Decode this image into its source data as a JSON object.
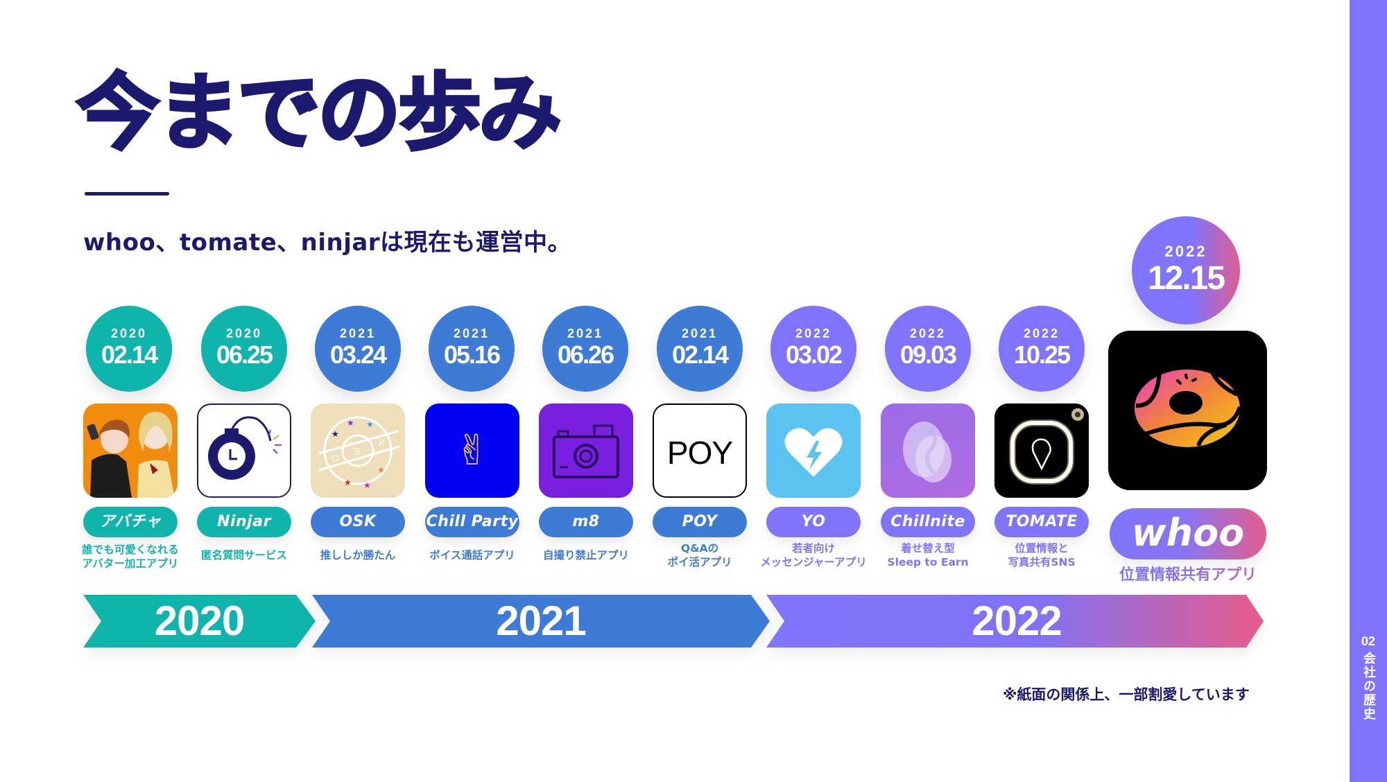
{
  "header": {
    "title": "今までの歩み",
    "subtitle": "whoo、tomate、ninjarは現在も運営中。"
  },
  "sidebar": {
    "section_number": "02",
    "section_label": "会社の歴史"
  },
  "colors": {
    "navy": "#1c1a6e",
    "teal_2020": "#0fb5ad",
    "blue_2021": "#3e7bd6",
    "purple_2022": "#7f74fb",
    "pink_accent": "#e45d8c"
  },
  "apps": [
    {
      "year": "2020",
      "date": "02.14",
      "name": "アバチャ",
      "desc": "誰でも可愛くなれる\nアバター加工アプリ",
      "icon": "avatar-photo-icon",
      "theme": "teal"
    },
    {
      "year": "2020",
      "date": "06.25",
      "name": "Ninjar",
      "desc": "匿名質問サービス",
      "icon": "bomb-clock-icon",
      "theme": "teal"
    },
    {
      "year": "2021",
      "date": "03.24",
      "name": "OSK",
      "desc": "推ししか勝たん",
      "icon": "osk-stars-logo-icon",
      "theme": "blue"
    },
    {
      "year": "2021",
      "date": "05.16",
      "name": "Chill Party",
      "desc": "ボイス通話アプリ",
      "icon": "peace-hand-icon",
      "theme": "blue"
    },
    {
      "year": "2021",
      "date": "06.26",
      "name": "m8",
      "desc": "自撮り禁止アプリ",
      "icon": "camera-icon",
      "theme": "blue"
    },
    {
      "year": "2021",
      "date": "02.14",
      "name": "POY",
      "desc": "Q&Aの\nポイ活アプリ",
      "icon": "poy-wordmark-icon",
      "icon_text": "POY",
      "theme": "blue"
    },
    {
      "year": "2022",
      "date": "03.02",
      "name": "YO",
      "desc": "若者向け\nメッセンジャーアプリ",
      "icon": "heart-bolt-icon",
      "theme": "purple"
    },
    {
      "year": "2022",
      "date": "09.03",
      "name": "Chillnite",
      "desc": "着せ替え型\nSleep to Earn",
      "icon": "blob-s-icon",
      "theme": "purple"
    },
    {
      "year": "2022",
      "date": "10.25",
      "name": "TOMATE",
      "desc": "位置情報と\n写真共有SNS",
      "icon": "glow-location-pin-icon",
      "theme": "purple"
    }
  ],
  "featured": {
    "year": "2022",
    "date": "12.15",
    "name": "whoo",
    "desc": "位置情報共有アプリ",
    "icon": "whoo-donut-icon"
  },
  "timeline": [
    {
      "label": "2020"
    },
    {
      "label": "2021"
    },
    {
      "label": "2022"
    }
  ],
  "footnote": "※紙面の関係上、一部割愛しています"
}
